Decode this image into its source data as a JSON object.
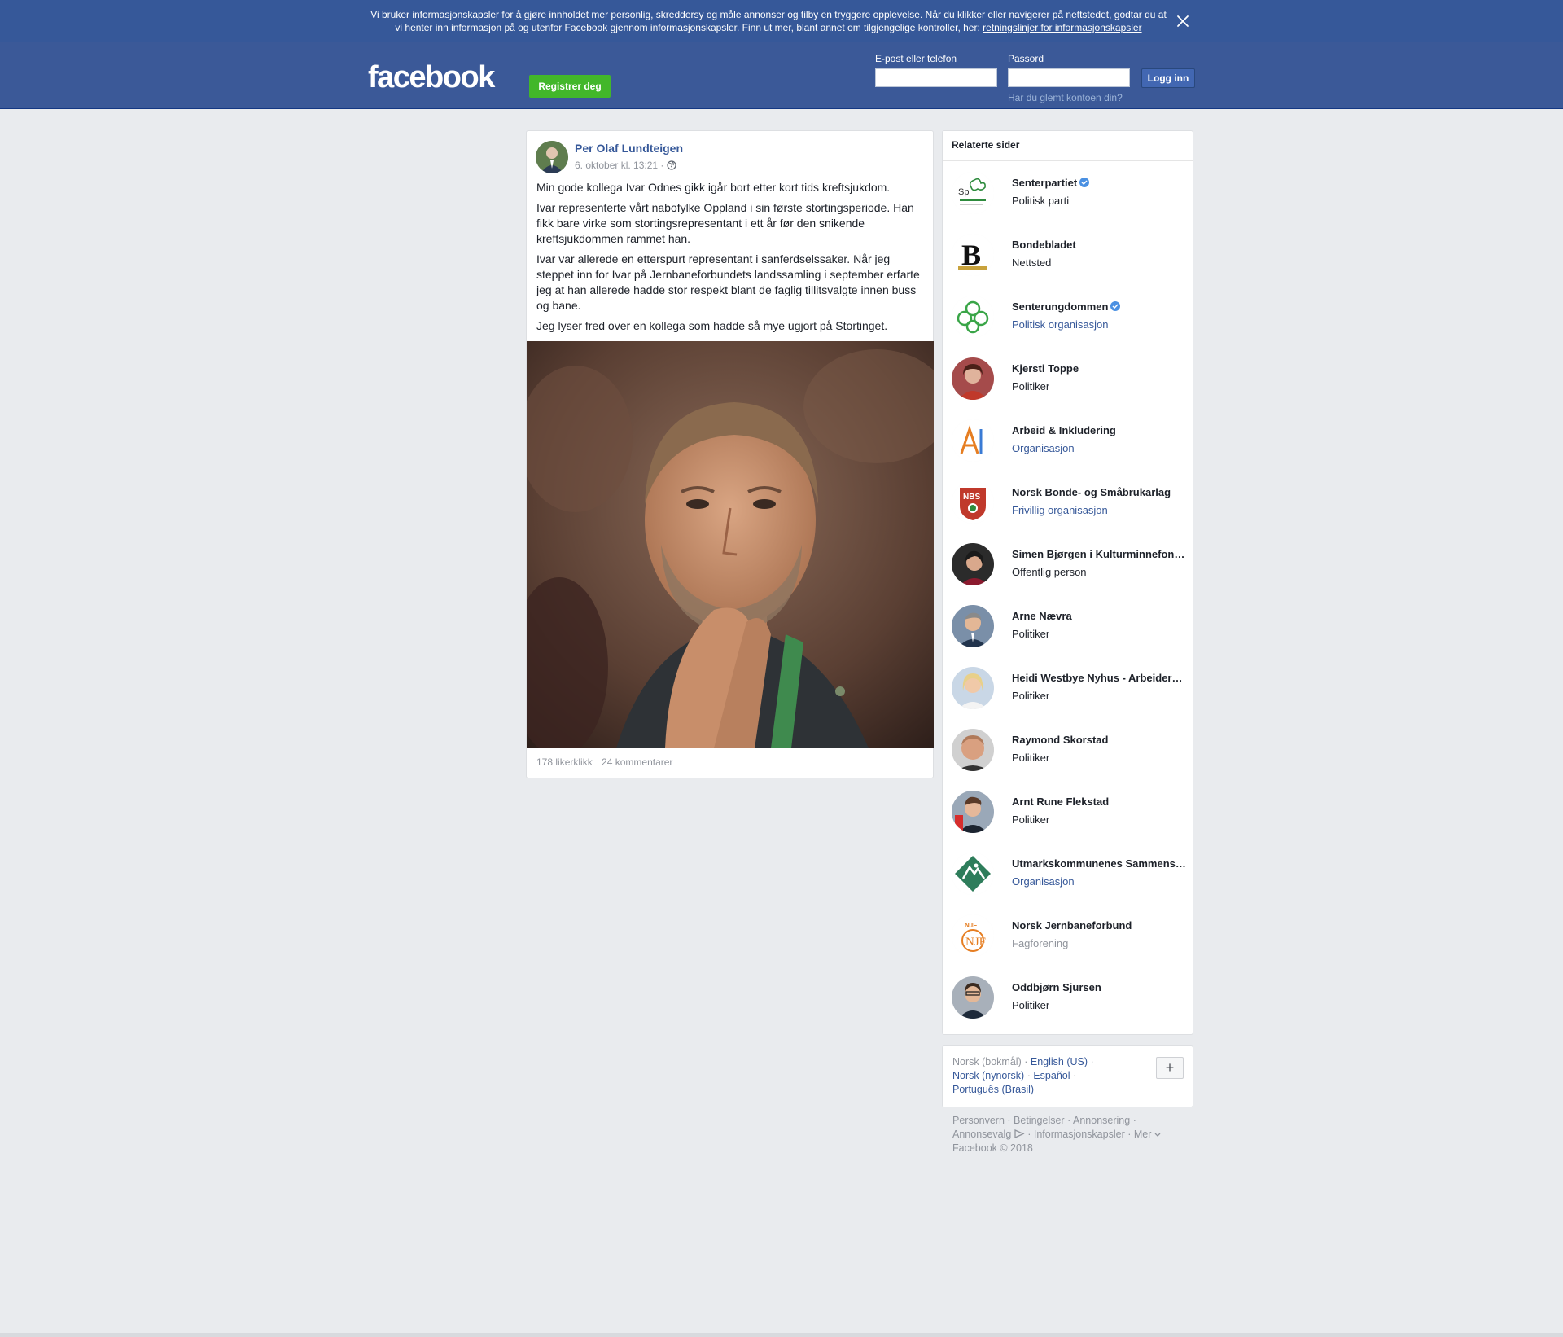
{
  "cookie_banner": {
    "text": "Vi bruker informasjonskapsler for å gjøre innholdet mer personlig, skreddersy og måle annonser og tilby en tryggere opplevelse. Når du klikker eller navigerer på nettstedet, godtar du at vi henter inn informasjon på og utenfor Facebook gjennom informasjonskapsler. Finn ut mer, blant annet om tilgjengelige kontroller, her: ",
    "link_text": "retningslinjer for informasjonskapsler"
  },
  "header": {
    "logo": "facebook",
    "register_label": "Registrer deg",
    "email_label": "E-post eller telefon",
    "email_value": "",
    "password_label": "Passord",
    "password_value": "",
    "login_label": "Logg inn",
    "forgot_label": "Har du glemt kontoen din?"
  },
  "post": {
    "author": "Per Olaf Lundteigen",
    "timestamp": "6. oktober kl. 13:21 ·",
    "paragraphs": [
      "Min gode kollega Ivar Odnes gikk igår bort etter kort tids kreftsjukdom.",
      "Ivar representerte vårt nabofylke Oppland i sin første stortingsperiode. Han fikk bare virke som stortingsrepresentant i ett år før den snikende kreftsjukdommen rammet han.",
      "Ivar var allerede en etterspurt representant i sanferdselssaker. Når jeg steppet inn for Ivar på Jernbaneforbundets landssamling i september erfarte jeg at han allerede hadde stor respekt blant de faglig tillitsvalgte innen buss og bane.",
      "Jeg lyser fred over en kollega som hadde så mye ugjort på Stortinget."
    ],
    "likes": "178 likerklikk",
    "comments": "24 kommentarer"
  },
  "related": {
    "title": "Relaterte sider",
    "items": [
      {
        "name": "Senterpartiet",
        "category": "Politisk parti",
        "verified": true,
        "cat_style": "plain"
      },
      {
        "name": "Bondebladet",
        "category": "Nettsted",
        "verified": false,
        "cat_style": "plain"
      },
      {
        "name": "Senterungdommen",
        "category": "Politisk organisasjon",
        "verified": true,
        "cat_style": "link"
      },
      {
        "name": "Kjersti Toppe",
        "category": "Politiker",
        "verified": false,
        "cat_style": "plain"
      },
      {
        "name": "Arbeid & Inkludering",
        "category": "Organisasjon",
        "verified": false,
        "cat_style": "link"
      },
      {
        "name": "Norsk Bonde- og Småbrukarlag",
        "category": "Frivillig organisasjon",
        "verified": false,
        "cat_style": "link"
      },
      {
        "name": "Simen Bjørgen i Kulturminnefondet",
        "category": "Offentlig person",
        "verified": false,
        "cat_style": "plain"
      },
      {
        "name": "Arne Nævra",
        "category": "Politiker",
        "verified": false,
        "cat_style": "plain"
      },
      {
        "name": "Heidi Westbye Nyhus - Arbeiderpartiet",
        "category": "Politiker",
        "verified": false,
        "cat_style": "plain"
      },
      {
        "name": "Raymond Skorstad",
        "category": "Politiker",
        "verified": false,
        "cat_style": "plain"
      },
      {
        "name": "Arnt Rune Flekstad",
        "category": "Politiker",
        "verified": false,
        "cat_style": "plain"
      },
      {
        "name": "Utmarkskommunenes Sammenslutning",
        "category": "Organisasjon",
        "verified": false,
        "cat_style": "link"
      },
      {
        "name": "Norsk Jernbaneforbund",
        "category": "Fagforening",
        "verified": false,
        "cat_style": "muted"
      },
      {
        "name": "Oddbjørn Sjursen",
        "category": "Politiker",
        "verified": false,
        "cat_style": "plain"
      }
    ]
  },
  "languages": {
    "current": "Norsk (bokmål)",
    "others": [
      "English (US)",
      "Norsk (nynorsk)",
      "Español",
      "Português (Brasil)"
    ],
    "plus_label": "+"
  },
  "footer": {
    "links": [
      "Personvern",
      "Betingelser",
      "Annonsering",
      "Annonsevalg",
      "Informasjonskapsler",
      "Mer"
    ],
    "copyright": "Facebook © 2018"
  },
  "colors": {
    "brand_blue": "#3b5998",
    "link_blue": "#365899",
    "register_green": "#42b72a",
    "page_bg": "#e9ebee"
  }
}
